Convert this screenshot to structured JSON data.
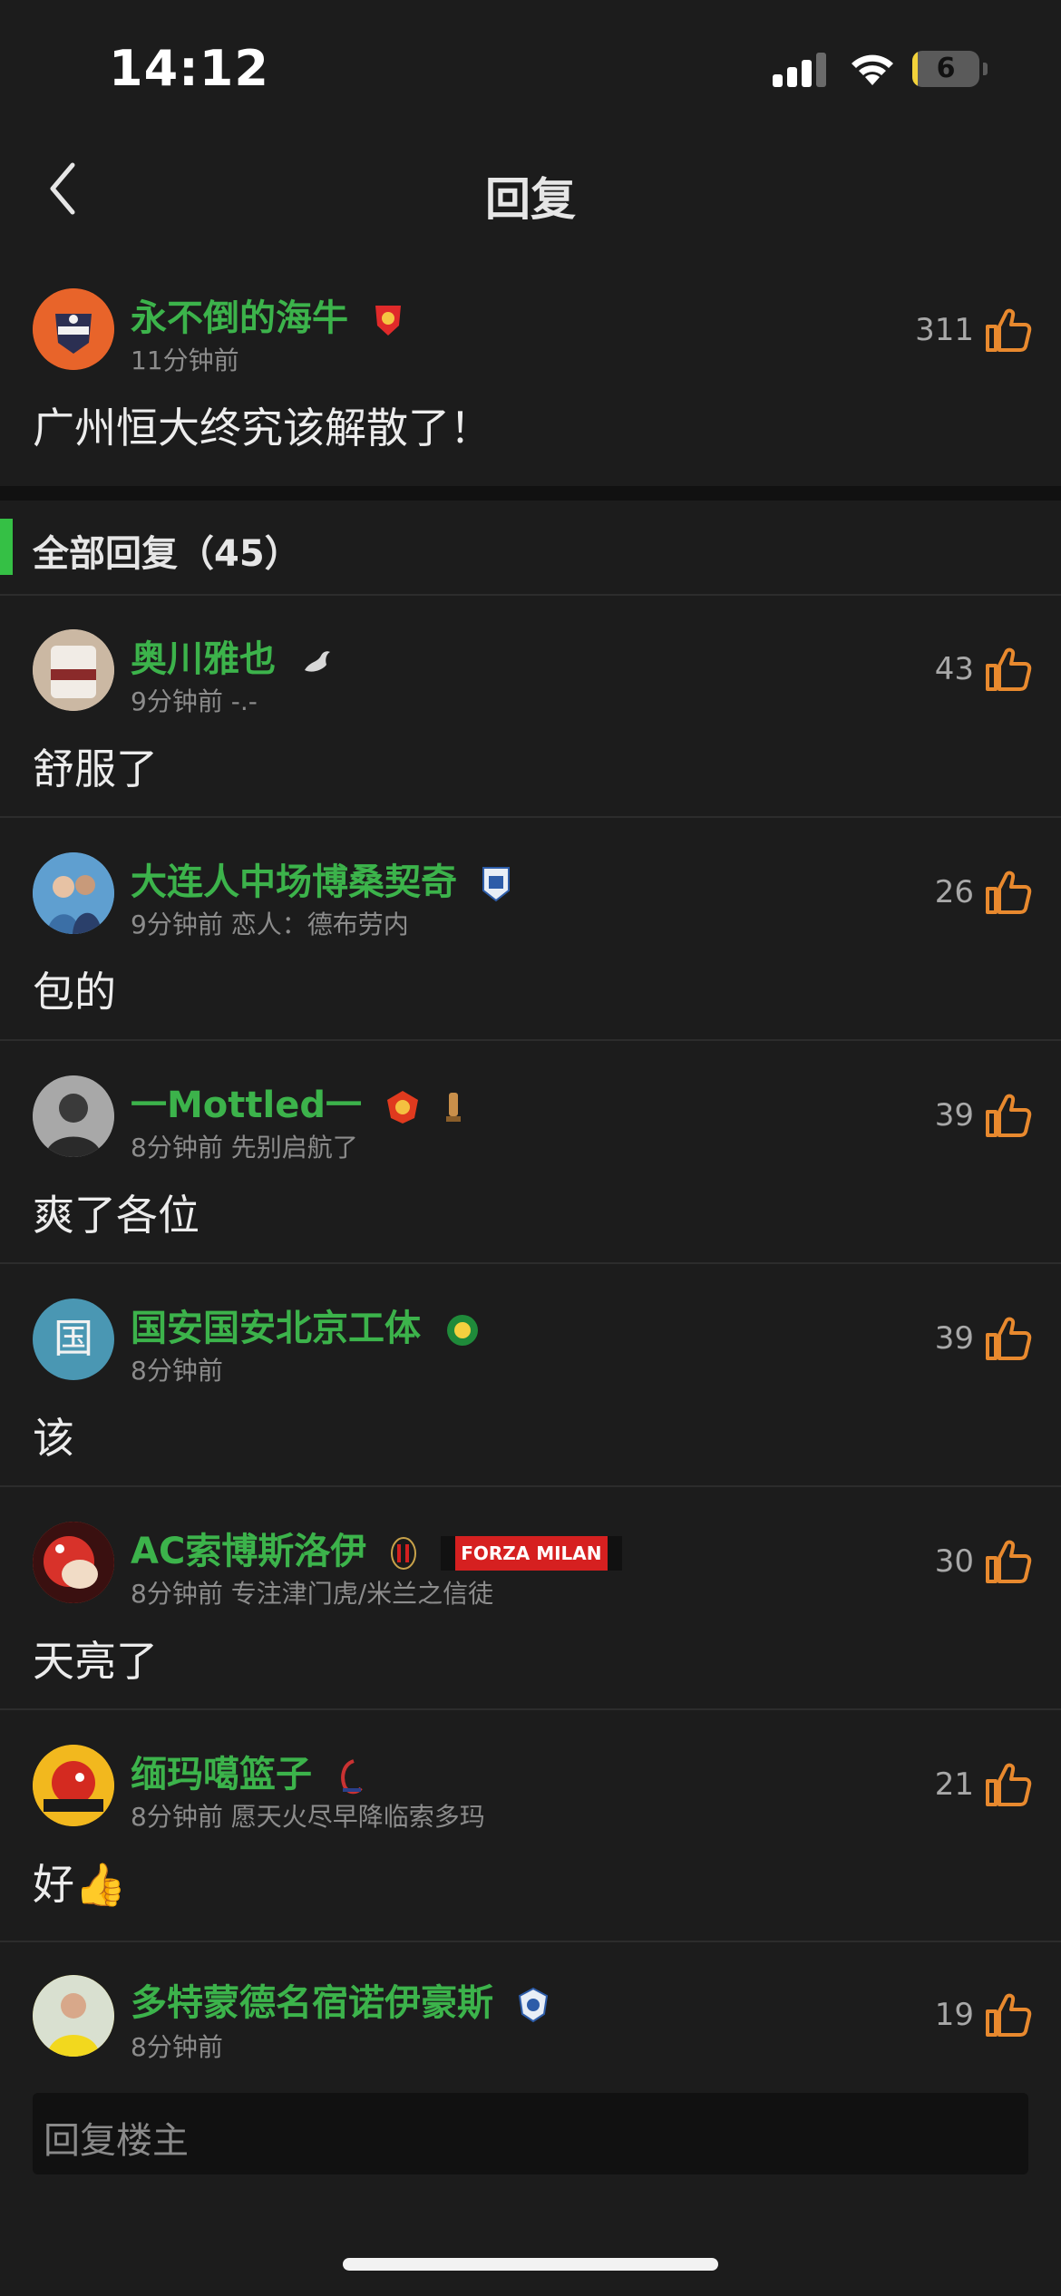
{
  "status_bar": {
    "time": "14:12",
    "battery": "6",
    "battery_level": 0.06
  },
  "nav": {
    "title": "回复"
  },
  "main_post": {
    "username": "永不倒的海牛",
    "time": "11分钟前",
    "likes": "311",
    "content": "广州恒大终究该解散了！"
  },
  "section": {
    "title": "全部回复（45）"
  },
  "replies": [
    {
      "username": "奥川雅也",
      "meta": "9分钟前  -.-",
      "likes": "43",
      "content": "舒服了"
    },
    {
      "username": "大连人中场博桑契奇",
      "meta": "9分钟前  恋人：德布劳内",
      "likes": "26",
      "content": "包的"
    },
    {
      "username": "一Mottled一",
      "meta": "8分钟前  先别启航了",
      "likes": "39",
      "content": "爽了各位"
    },
    {
      "username": "国安国安北京工体",
      "meta": "8分钟前",
      "likes": "39",
      "content": "该",
      "avatar_char": "国"
    },
    {
      "username": "AC索博斯洛伊",
      "meta": "8分钟前  专注津门虎/米兰之信徒",
      "likes": "30",
      "content": "天亮了",
      "scarf_text": "FORZA MILAN"
    },
    {
      "username": "缅玛噶篮子",
      "meta": "8分钟前  愿天火尽早降临索多玛",
      "likes": "21",
      "content": "好👍"
    },
    {
      "username": "多特蒙德名宿诺伊豪斯",
      "meta": "8分钟前",
      "likes": "19",
      "content": ""
    }
  ],
  "reply_input": {
    "placeholder": "回复楼主"
  },
  "colors": {
    "background": "#1c1c1c",
    "username_green": "#3cb34b",
    "like_orange": "#e8892e",
    "section_accent": "#35c045"
  },
  "icons": [
    "back-chevron-icon",
    "signal-icon",
    "wifi-icon",
    "battery-icon",
    "thumbs-up-icon"
  ]
}
